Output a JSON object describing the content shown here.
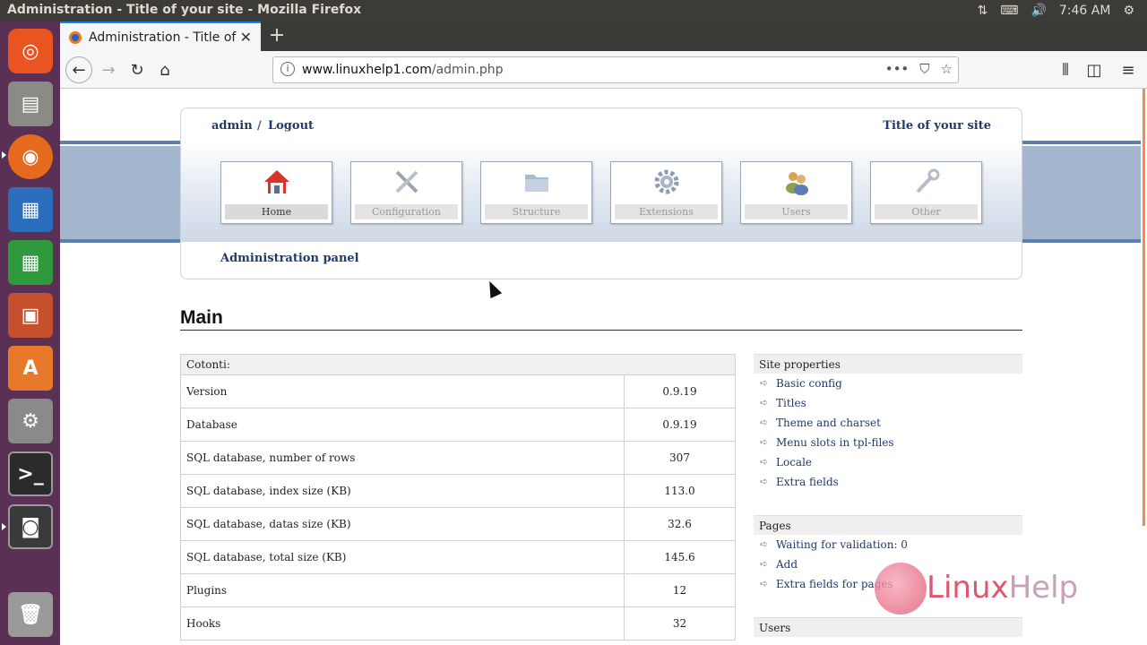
{
  "system": {
    "window_title": "Administration - Title of your site - Mozilla Firefox",
    "clock": "7:46 AM"
  },
  "browser": {
    "tab_title": "Administration - Title of your site",
    "new_tab": "+",
    "url_domain": "www.linuxhelp1.com",
    "url_path": "/admin.php",
    "urlbar_actions": [
      "•••",
      "pocket-icon",
      "star-icon"
    ]
  },
  "header": {
    "user": "admin",
    "separator": "/",
    "logout": "Logout",
    "site_title": "Title of your site"
  },
  "nav_tiles": [
    {
      "label": "Home",
      "icon": "home-icon",
      "active": true
    },
    {
      "label": "Configuration",
      "icon": "tools-icon",
      "active": false
    },
    {
      "label": "Structure",
      "icon": "folder-icon",
      "active": false
    },
    {
      "label": "Extensions",
      "icon": "gear-icon",
      "active": false
    },
    {
      "label": "Users",
      "icon": "users-icon",
      "active": false
    },
    {
      "label": "Other",
      "icon": "wrench-icon",
      "active": false
    }
  ],
  "breadcrumb": "Administration panel",
  "main": {
    "title": "Main",
    "table_header": "Cotonti:",
    "rows": [
      {
        "label": "Version",
        "value": "0.9.19"
      },
      {
        "label": "Database",
        "value": "0.9.19"
      },
      {
        "label": "SQL database, number of rows",
        "value": "307"
      },
      {
        "label": "SQL database, index size (KB)",
        "value": "113.0"
      },
      {
        "label": "SQL database, datas size (KB)",
        "value": "32.6"
      },
      {
        "label": "SQL database, total size (KB)",
        "value": "145.6"
      },
      {
        "label": "Plugins",
        "value": "12"
      },
      {
        "label": "Hooks",
        "value": "32"
      }
    ]
  },
  "sidebar": {
    "site_properties": {
      "title": "Site properties",
      "items": [
        "Basic config",
        "Titles",
        "Theme and charset",
        "Menu slots in tpl-files",
        "Locale",
        "Extra fields"
      ]
    },
    "pages": {
      "title": "Pages",
      "items": [
        "Waiting for validation: 0",
        "Add",
        "Extra fields for pages"
      ]
    },
    "users": {
      "title": "Users"
    }
  },
  "watermark": {
    "text_a": "Linux",
    "text_b": "Help"
  }
}
